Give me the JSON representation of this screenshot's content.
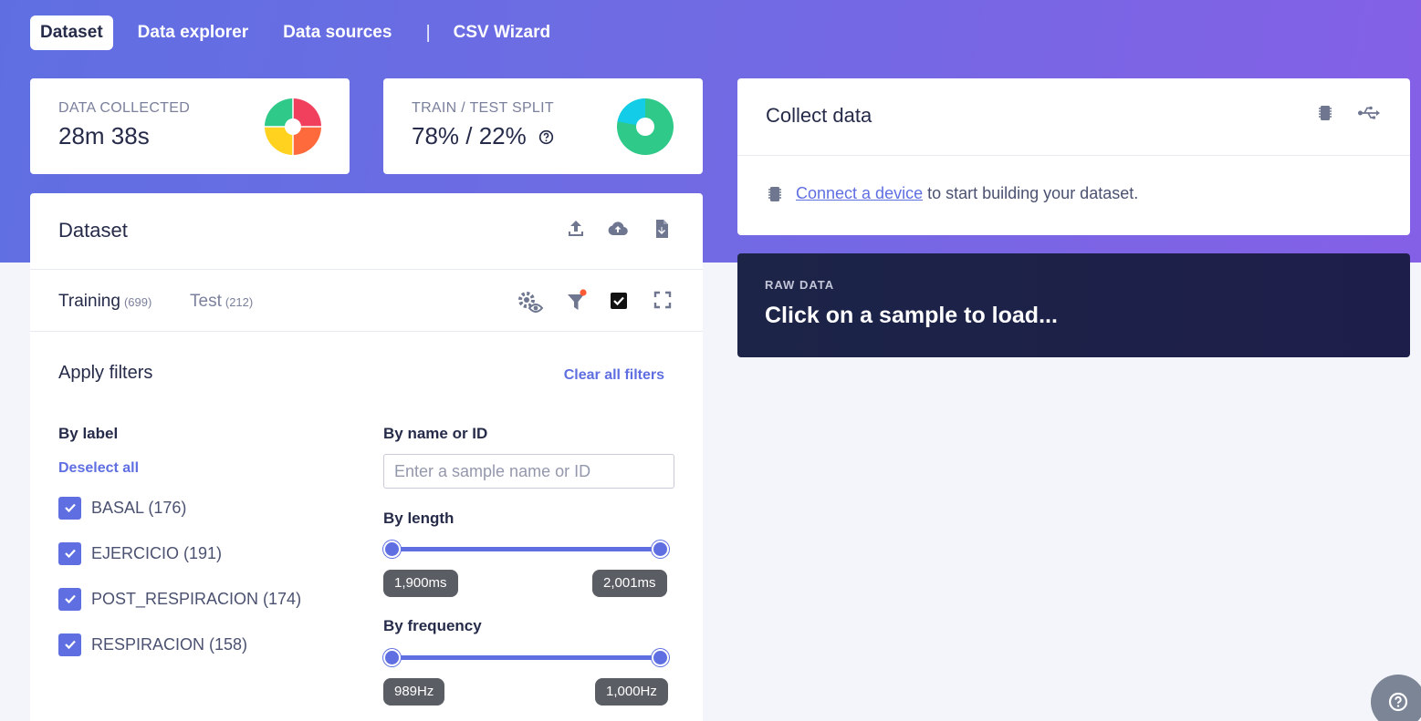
{
  "nav": {
    "tabs": [
      {
        "label": "Dataset",
        "active": true
      },
      {
        "label": "Data explorer",
        "active": false
      },
      {
        "label": "Data sources",
        "active": false
      },
      {
        "label": "CSV Wizard",
        "active": false
      }
    ],
    "separator": "|"
  },
  "stats": {
    "data_collected": {
      "label": "DATA COLLECTED",
      "value": "28m 38s",
      "chart_colors": [
        "#f0405e",
        "#ff6a3d",
        "#ffd21f",
        "#2fc98a"
      ]
    },
    "split": {
      "label": "TRAIN / TEST SPLIT",
      "value": "78% / 22%",
      "train_fraction": 0.78,
      "chart_colors": [
        "#2fc98a",
        "#12cce8"
      ]
    }
  },
  "dataset": {
    "title": "Dataset",
    "actions": [
      "upload-icon",
      "cloud-upload-icon",
      "export-icon"
    ],
    "tabs": [
      {
        "label": "Training",
        "count": "(699)",
        "active": true
      },
      {
        "label": "Test",
        "count": "(212)",
        "active": false
      }
    ],
    "filters": {
      "title": "Apply filters",
      "clear_label": "Clear all filters",
      "by_label": "By label",
      "deselect_label": "Deselect all",
      "labels": [
        {
          "text": "BASAL (176)",
          "checked": true
        },
        {
          "text": "EJERCICIO (191)",
          "checked": true
        },
        {
          "text": "POST_RESPIRACION (174)",
          "checked": true
        },
        {
          "text": "RESPIRACION (158)",
          "checked": true
        }
      ],
      "by_name": "By name or ID",
      "name_placeholder": "Enter a sample name or ID",
      "name_value": "",
      "by_length": "By length",
      "length_min": "1,900ms",
      "length_max": "2,001ms",
      "by_frequency": "By frequency",
      "freq_min": "989Hz",
      "freq_max": "1,000Hz"
    }
  },
  "collect": {
    "title": "Collect data",
    "link": "Connect a device",
    "rest": "to start building your dataset."
  },
  "raw": {
    "label": "RAW DATA",
    "text": "Click on a sample to load..."
  },
  "colors": {
    "accent": "#5f6fe2",
    "dark_panel": "#1c2447"
  }
}
